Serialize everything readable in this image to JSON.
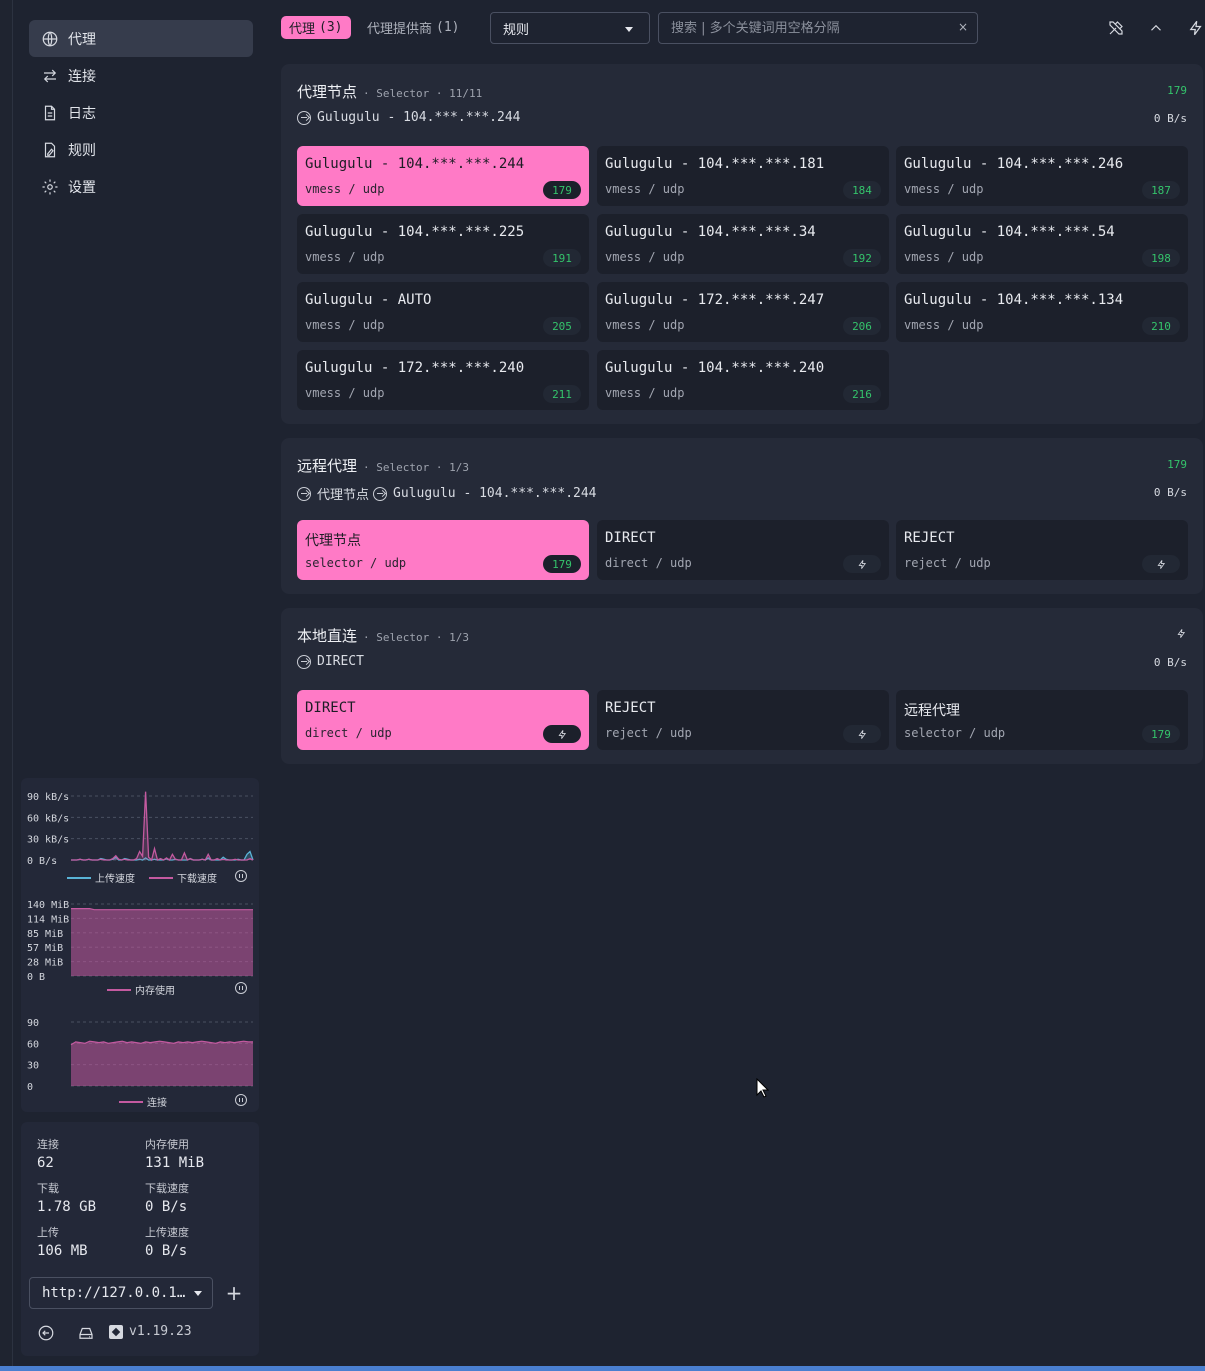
{
  "nav": [
    {
      "label": "代理",
      "icon": "globe-icon",
      "active": true
    },
    {
      "label": "连接",
      "icon": "arrows-icon",
      "active": false
    },
    {
      "label": "日志",
      "icon": "document-icon",
      "active": false
    },
    {
      "label": "规则",
      "icon": "rules-icon",
      "active": false
    },
    {
      "label": "设置",
      "icon": "gear-icon",
      "active": false
    }
  ],
  "topbar": {
    "tab_proxies_label": "代理",
    "tab_proxies_count": "(3)",
    "tab_providers_label": "代理提供商",
    "tab_providers_count": "(1)",
    "mode": "规则",
    "search_placeholder": "搜索 | 多个关键词用空格分隔",
    "search_clear": "×"
  },
  "groups": [
    {
      "name": "代理节点",
      "meta": "· Selector · 11/11",
      "latency": "179",
      "now": "Gulugulu - 104.***.***.244",
      "speed": "0 B/s",
      "cards": [
        {
          "name": "Gulugulu - 104.***.***.244",
          "type": "vmess / udp",
          "latency": "179",
          "active": true
        },
        {
          "name": "Gulugulu - 104.***.***.181",
          "type": "vmess / udp",
          "latency": "184"
        },
        {
          "name": "Gulugulu - 104.***.***.246",
          "type": "vmess / udp",
          "latency": "187"
        },
        {
          "name": "Gulugulu - 104.***.***.225",
          "type": "vmess / udp",
          "latency": "191"
        },
        {
          "name": "Gulugulu - 104.***.***.34",
          "type": "vmess / udp",
          "latency": "192"
        },
        {
          "name": "Gulugulu - 104.***.***.54",
          "type": "vmess / udp",
          "latency": "198"
        },
        {
          "name": "Gulugulu - AUTO",
          "type": "vmess / udp",
          "latency": "205"
        },
        {
          "name": "Gulugulu - 172.***.***.247",
          "type": "vmess / udp",
          "latency": "206"
        },
        {
          "name": "Gulugulu - 104.***.***.134",
          "type": "vmess / udp",
          "latency": "210"
        },
        {
          "name": "Gulugulu - 172.***.***.240",
          "type": "vmess / udp",
          "latency": "211"
        },
        {
          "name": "Gulugulu - 104.***.***.240",
          "type": "vmess / udp",
          "latency": "216"
        }
      ]
    },
    {
      "name": "远程代理",
      "meta": "· Selector · 1/3",
      "latency": "179",
      "now_prefix": "代理节点",
      "now": "Gulugulu - 104.***.***.244",
      "speed": "0 B/s",
      "cards": [
        {
          "name": "代理节点",
          "type": "selector / udp",
          "latency": "179",
          "active": true
        },
        {
          "name": "DIRECT",
          "type": "direct / udp",
          "latency": ""
        },
        {
          "name": "REJECT",
          "type": "reject / udp",
          "latency": ""
        }
      ]
    },
    {
      "name": "本地直连",
      "meta": "· Selector · 1/3",
      "latency": "",
      "now": "DIRECT",
      "speed": "0 B/s",
      "cards": [
        {
          "name": "DIRECT",
          "type": "direct / udp",
          "latency": "",
          "active": true
        },
        {
          "name": "REJECT",
          "type": "reject / udp",
          "latency": ""
        },
        {
          "name": "远程代理",
          "type": "selector / udp",
          "latency": "179"
        }
      ]
    }
  ],
  "chart_data": [
    {
      "type": "line",
      "yticks": [
        "90 kB/s",
        "60 kB/s",
        "30 kB/s",
        "0 B/s"
      ],
      "ylim": [
        0,
        90
      ],
      "series": [
        {
          "name": "上传速度",
          "color": "#59b3d6",
          "values": [
            0,
            0,
            0,
            1,
            0,
            0,
            1,
            0,
            0,
            0,
            2,
            1,
            0,
            0,
            1,
            4,
            0,
            0,
            2,
            1,
            0,
            0,
            0,
            1,
            0,
            3,
            0,
            0,
            1,
            0,
            0,
            0,
            2,
            0,
            0,
            1,
            0,
            0,
            0,
            0,
            2,
            0,
            0,
            0,
            1,
            0,
            3,
            0,
            0,
            0,
            0,
            4,
            1,
            0,
            0,
            0,
            1,
            0,
            0,
            8,
            12,
            0
          ]
        },
        {
          "name": "下载速度",
          "color": "#c45aa0",
          "values": [
            0,
            0,
            0,
            1,
            0,
            0,
            1,
            0,
            0,
            0,
            1,
            0,
            0,
            0,
            2,
            6,
            1,
            0,
            1,
            0,
            0,
            0,
            2,
            12,
            5,
            96,
            4,
            0,
            16,
            0,
            2,
            0,
            3,
            0,
            8,
            1,
            0,
            0,
            10,
            0,
            2,
            0,
            0,
            0,
            1,
            0,
            8,
            0,
            0,
            2,
            0,
            1,
            0,
            0,
            0,
            1,
            0,
            0,
            0,
            0,
            2,
            0
          ]
        }
      ]
    },
    {
      "type": "area",
      "yticks": [
        "140 MiB",
        "114 MiB",
        "85 MiB",
        "57 MiB",
        "28 MiB",
        "0 B"
      ],
      "ylim": [
        0,
        140
      ],
      "series": [
        {
          "name": "内存使用",
          "color": "#c45aa0",
          "values": [
            131,
            131,
            131,
            131,
            131,
            129,
            129,
            129,
            129,
            129,
            129,
            129,
            129,
            129,
            129,
            129,
            129,
            129,
            129,
            129,
            129,
            129,
            129,
            129,
            129,
            129,
            129,
            129,
            129,
            129,
            129,
            129,
            129,
            129,
            129,
            129,
            129,
            129,
            129,
            129
          ]
        }
      ]
    },
    {
      "type": "area",
      "yticks": [
        "90",
        "60",
        "30",
        "0"
      ],
      "ylim": [
        0,
        90
      ],
      "series": [
        {
          "name": "连接",
          "color": "#c45aa0",
          "values": [
            58,
            62,
            61,
            60,
            63,
            62,
            61,
            62,
            60,
            61,
            62,
            63,
            61,
            62,
            61,
            60,
            62,
            61,
            62,
            63,
            62,
            61,
            60,
            62,
            61,
            62,
            61,
            62,
            63,
            62,
            61,
            60,
            62,
            61,
            62,
            61,
            62,
            63,
            62,
            62
          ]
        }
      ]
    }
  ],
  "stats": {
    "conn_label": "连接",
    "conn": "62",
    "mem_label": "内存使用",
    "mem": "131 MiB",
    "down_label": "下载",
    "down": "1.78 GB",
    "downspeed_label": "下载速度",
    "downspeed": "0 B/s",
    "up_label": "上传",
    "up": "106 MB",
    "upspeed_label": "上传速度",
    "upspeed": "0 B/s"
  },
  "backend": "http://127.0.0.1…",
  "add_label": "+",
  "version": "v1.19.23"
}
